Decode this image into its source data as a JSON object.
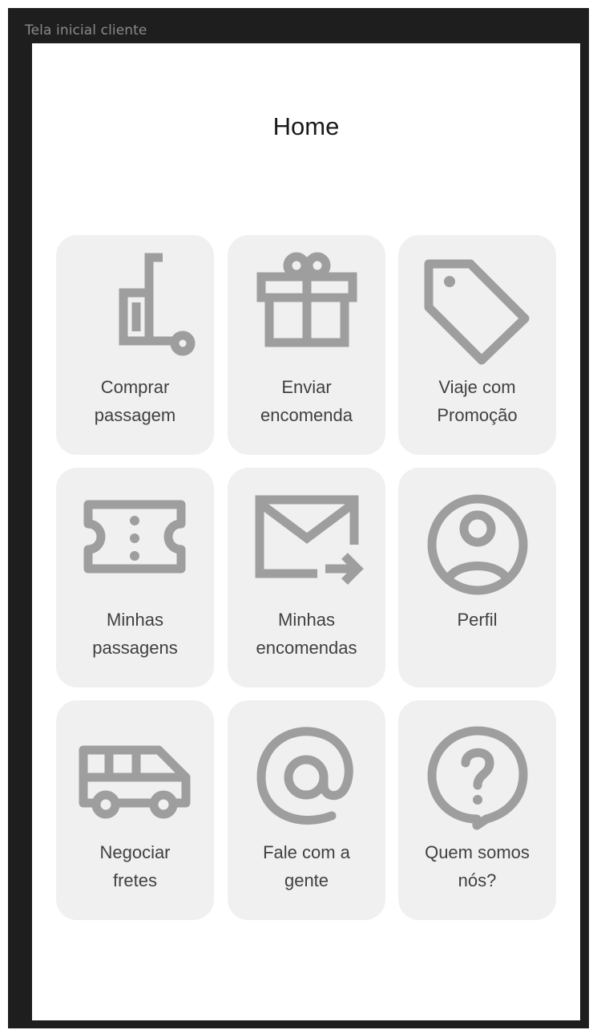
{
  "frame_label": "Tela inicial cliente",
  "header": {
    "title": "Home"
  },
  "colors": {
    "background": "#1e1e1e",
    "screen": "#ffffff",
    "tile": "#f0f0f0",
    "icon": "#9e9e9e",
    "text": "#404040"
  },
  "menu": {
    "tiles": [
      {
        "label": "Comprar\npassagem",
        "icon": "luggage-icon"
      },
      {
        "label": "Enviar\nencomenda",
        "icon": "gift-icon"
      },
      {
        "label": "Viaje com\nPromoção",
        "icon": "tag-icon"
      },
      {
        "label": "Minhas\npassagens",
        "icon": "ticket-icon"
      },
      {
        "label": "Minhas\nencomendas",
        "icon": "mail-forward-icon"
      },
      {
        "label": "Perfil",
        "icon": "user-circle-icon"
      },
      {
        "label": "Negociar\nfretes",
        "icon": "van-icon"
      },
      {
        "label": "Fale com a\ngente",
        "icon": "at-sign-icon"
      },
      {
        "label": "Quem somos\nnós?",
        "icon": "help-bubble-icon"
      }
    ]
  }
}
